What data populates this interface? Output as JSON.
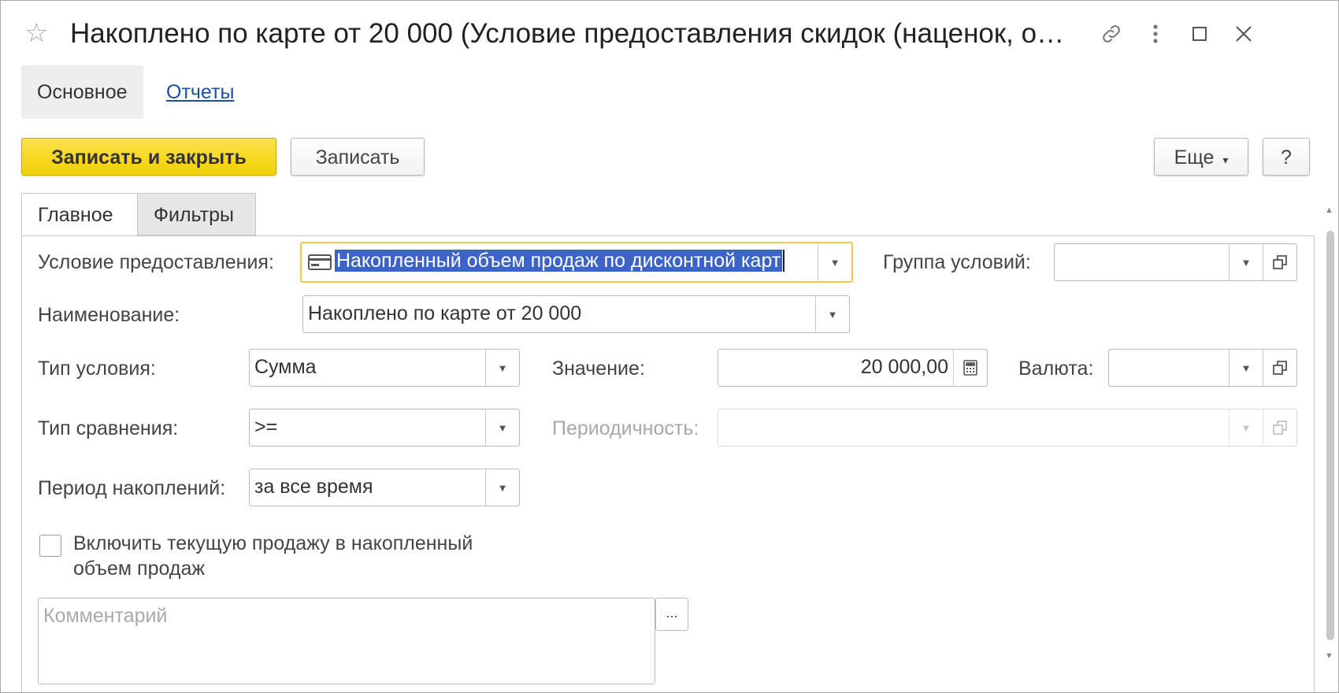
{
  "window": {
    "title": "Накоплено по карте от 20 000 (Условие предоставления скидок (наценок, о…",
    "icons": [
      "star-icon",
      "link-icon",
      "more-vertical-icon",
      "maximize-icon",
      "close-icon"
    ]
  },
  "sections": {
    "main": "Основное",
    "reports": "Отчеты"
  },
  "toolbar": {
    "save_close": "Записать и закрыть",
    "save": "Записать",
    "more": "Еще",
    "more_arrow": "▾",
    "help": "?"
  },
  "tabs": {
    "main": "Главное",
    "filters": "Фильтры"
  },
  "form": {
    "condition_label": "Условие предоставления:",
    "condition_value": "Накопленный объем продаж по дисконтной карт",
    "group_label": "Группа условий:",
    "group_value": "",
    "name_label": "Наименование:",
    "name_value": "Накоплено по карте от 20 000",
    "type_label": "Тип условия:",
    "type_value": "Сумма",
    "value_label": "Значение:",
    "value_value": "20 000,00",
    "currency_label": "Валюта:",
    "currency_value": "",
    "compare_label": "Тип сравнения:",
    "compare_value": ">=",
    "periodicity_label": "Периодичность:",
    "periodicity_value": "",
    "period_label": "Период накоплений:",
    "period_value": "за все время",
    "include_current_line1": "Включить текущую продажу в накопленный",
    "include_current_line2": "объем продаж",
    "include_current_checked": false,
    "comment_placeholder": "Комментарий",
    "comment_more": "..."
  },
  "colors": {
    "primary_button": "#f3d000",
    "selection": "#3c64c8",
    "link": "#1b4fa0",
    "focus_border": "#f2c94c"
  }
}
